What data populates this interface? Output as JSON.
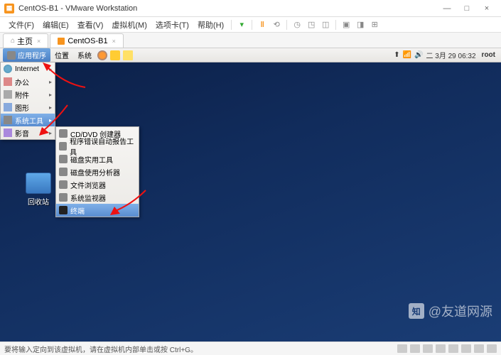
{
  "window": {
    "title": "CentOS-B1 - VMware Workstation",
    "min": "—",
    "max": "□",
    "close": "×"
  },
  "menubar": {
    "items": [
      "文件(F)",
      "编辑(E)",
      "查看(V)",
      "虚拟机(M)",
      "选项卡(T)",
      "帮助(H)"
    ]
  },
  "tabs": {
    "home": "主页",
    "vm": "CentOS-B1"
  },
  "gnome": {
    "apps": "应用程序",
    "places": "位置",
    "system": "系统",
    "date": "二  3月 29 06:32",
    "user": "root"
  },
  "app_menu": [
    {
      "label": "Internet",
      "icon": "ic-globe"
    },
    {
      "label": "办公",
      "icon": "ic-office"
    },
    {
      "label": "附件",
      "icon": "ic-attach"
    },
    {
      "label": "图形",
      "icon": "ic-graphic"
    },
    {
      "label": "系统工具",
      "icon": "ic-tools",
      "hl": true
    },
    {
      "label": "影音",
      "icon": "ic-media"
    }
  ],
  "sub_menu": [
    {
      "label": "CD/DVD 创建器"
    },
    {
      "label": "程序错误自动报告工具"
    },
    {
      "label": "磁盘实用工具"
    },
    {
      "label": "磁盘使用分析器"
    },
    {
      "label": "文件浏览器"
    },
    {
      "label": "系统监视器"
    },
    {
      "label": "终端",
      "hl": true
    }
  ],
  "desktop": {
    "trash": "回收站"
  },
  "watermark": {
    "logo": "知",
    "text": "@友道网源"
  },
  "statusbar": {
    "text": "要将输入定向到该虚拟机，请在虚拟机内部单击或按 Ctrl+G。"
  }
}
